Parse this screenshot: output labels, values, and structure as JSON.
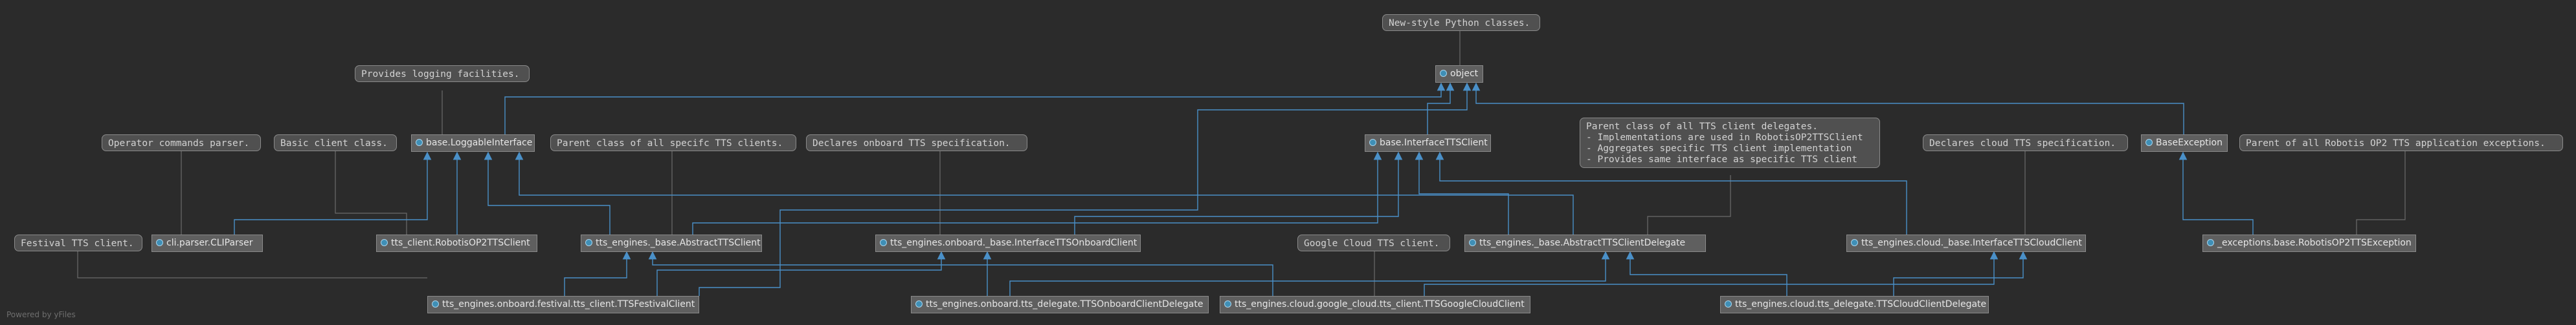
{
  "footer": "Powered by yFiles",
  "nodes": {
    "object": "object",
    "loggable": "base.LoggableInterface",
    "interface_tts": "base.InterfaceTTSClient",
    "base_exception": "BaseException",
    "cliparser": "cli.parser.CLIParser",
    "robotis_client": "tts_client.RobotisOP2TTSClient",
    "abstract_client": "tts_engines._base.AbstractTTSClient",
    "onboard_iface": "tts_engines.onboard._base.InterfaceTTSOnboardClient",
    "abstract_delegate": "tts_engines._base.AbstractTTSClientDelegate",
    "cloud_iface": "tts_engines.cloud._base.InterfaceTTSCloudClient",
    "exception": "_exceptions.base.RobotisOP2TTSException",
    "festival": "tts_engines.onboard.festival.tts_client.TTSFestivalClient",
    "onboard_delegate": "tts_engines.onboard.tts_delegate.TTSOnboardClientDelegate",
    "google_cloud": "tts_engines.cloud.google_cloud.tts_client.TTSGoogleCloudClient",
    "cloud_delegate": "tts_engines.cloud.tts_delegate.TTSCloudClientDelegate"
  },
  "notes": {
    "new_style": "New-style Python classes.",
    "logging": "Provides logging facilities.",
    "operator": "Operator commands parser.",
    "basic": "Basic client class.",
    "parent_tts": "Parent class of all specifc TTS clients.",
    "onboard_spec": "Declares onboard TTS specification.",
    "delegates": "Parent class of all TTS client delegates.\n- Implementations are used in RobotisOP2TTSClient\n- Aggregates specific TTS client implementation\n- Provides same interface as specific TTS client",
    "cloud_spec": "Declares cloud TTS specification.",
    "exceptions": "Parent of all Robotis OP2 TTS application exceptions.",
    "festival": "Festival TTS client.",
    "google": "Google Cloud TTS client."
  }
}
